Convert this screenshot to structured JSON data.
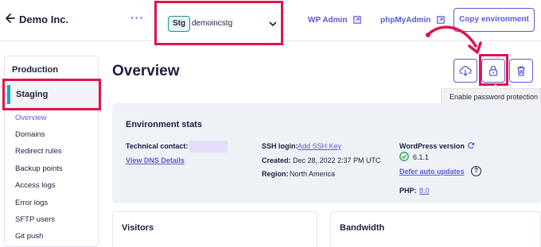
{
  "header": {
    "site_name": "Demo Inc.",
    "env_badge": "Stg",
    "env_name": "demoincstg",
    "wp_admin": "WP Admin",
    "phpmyadmin": "phpMyAdmin",
    "copy_env": "Copy environment",
    "icons": [
      "back-arrow-icon",
      "more-dots-icon",
      "chevron-down-icon",
      "external-link-icon"
    ]
  },
  "sidebar": {
    "production": "Production",
    "staging": "Staging",
    "items": [
      "Overview",
      "Domains",
      "Redirect rules",
      "Backup points",
      "Access logs",
      "Error logs",
      "SFTP users",
      "Git push"
    ],
    "active_item": "Overview"
  },
  "main": {
    "title": "Overview",
    "actions": [
      "download-icon",
      "lock-icon",
      "trash-icon"
    ],
    "tooltip": "Enable password protection"
  },
  "stats": {
    "title": "Environment stats",
    "technical_contact_label": "Technical contact:",
    "view_dns": "View DNS Details",
    "ssh_label": "SSH login:",
    "ssh_link": "Add SSH Key",
    "created_label": "Created:",
    "created_value": "Dec 28, 2022 2:37 PM UTC",
    "region_label": "Region:",
    "region_value": "North America",
    "wp_version_label": "WordPress version",
    "wp_version": "6.1.1",
    "defer_updates": "Defer auto updates",
    "help": "?",
    "php_label": "PHP:",
    "php_version": "8.0"
  },
  "cards": {
    "visitors": "Visitors",
    "bandwidth": "Bandwidth"
  },
  "colors": {
    "accent": "#5b5bd6",
    "highlight": "#e0144c",
    "staging_bar": "#1aa9b4",
    "success": "#1f9d55"
  }
}
